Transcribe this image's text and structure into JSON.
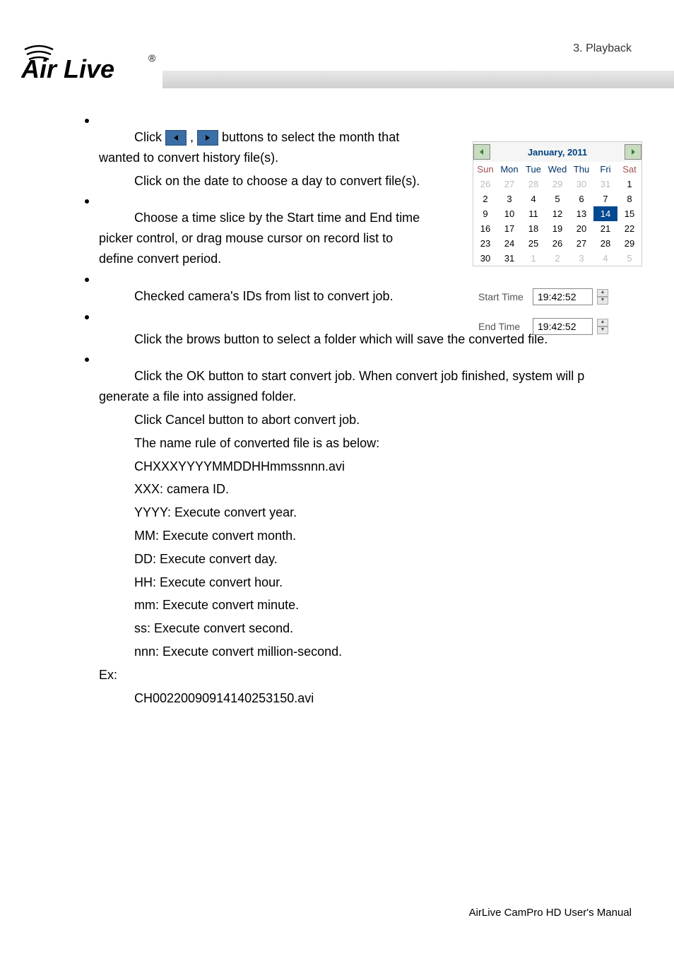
{
  "header": {
    "section_label": "3. Playback",
    "logo_alt": "Air Live"
  },
  "content": {
    "p1a": "Click ",
    "p1b": " , ",
    "p1c": " buttons to select the month that wanted to convert history file(s).",
    "p2": "Click on the date to choose a day to convert file(s).",
    "p3": " Choose a time slice by the Start time and End time picker control, or drag mouse cursor on record list to define convert period.",
    "p4": "Checked camera's IDs from list to convert job.",
    "p5": "Click the brows button to select a folder which will save the converted file.",
    "p6": "Click the OK button to start convert job. When convert job finished, system will p generate a file into assigned folder.",
    "p7": "Click Cancel button to abort convert job.",
    "p8": "The name rule of converted file is as below:",
    "p9": "CHXXXYYYYMMDDHHmmssnnn.avi",
    "p10": "XXX: camera ID.",
    "p11": "YYYY: Execute convert year.",
    "p12": "MM: Execute convert month.",
    "p13": "DD: Execute convert day.",
    "p14": "HH: Execute convert hour.",
    "p15": "mm: Execute convert minute.",
    "p16": "ss: Execute convert second.",
    "p17": "nnn: Execute convert million-second.",
    "ex_label": "Ex:",
    "ex_value": "CH00220090914140253150.avi"
  },
  "calendar": {
    "title": "January, 2011",
    "days": [
      "Sun",
      "Mon",
      "Tue",
      "Wed",
      "Thu",
      "Fri",
      "Sat"
    ],
    "weeks": [
      [
        {
          "d": "26",
          "dim": true
        },
        {
          "d": "27",
          "dim": true
        },
        {
          "d": "28",
          "dim": true
        },
        {
          "d": "29",
          "dim": true
        },
        {
          "d": "30",
          "dim": true
        },
        {
          "d": "31",
          "dim": true
        },
        {
          "d": "1"
        }
      ],
      [
        {
          "d": "2"
        },
        {
          "d": "3"
        },
        {
          "d": "4"
        },
        {
          "d": "5"
        },
        {
          "d": "6"
        },
        {
          "d": "7"
        },
        {
          "d": "8"
        }
      ],
      [
        {
          "d": "9"
        },
        {
          "d": "10"
        },
        {
          "d": "11"
        },
        {
          "d": "12"
        },
        {
          "d": "13"
        },
        {
          "d": "14",
          "sel": true
        },
        {
          "d": "15"
        }
      ],
      [
        {
          "d": "16"
        },
        {
          "d": "17"
        },
        {
          "d": "18"
        },
        {
          "d": "19"
        },
        {
          "d": "20"
        },
        {
          "d": "21"
        },
        {
          "d": "22"
        }
      ],
      [
        {
          "d": "23"
        },
        {
          "d": "24"
        },
        {
          "d": "25"
        },
        {
          "d": "26"
        },
        {
          "d": "27"
        },
        {
          "d": "28"
        },
        {
          "d": "29"
        }
      ],
      [
        {
          "d": "30"
        },
        {
          "d": "31"
        },
        {
          "d": "1",
          "dim": true
        },
        {
          "d": "2",
          "dim": true
        },
        {
          "d": "3",
          "dim": true
        },
        {
          "d": "4",
          "dim": true
        },
        {
          "d": "5",
          "dim": true
        }
      ]
    ]
  },
  "time": {
    "start_label": "Start Time",
    "start_value": "19:42:52",
    "end_label": "End Time",
    "end_value": "19:42:52"
  },
  "footer": {
    "text": "AirLive CamPro HD User's Manual"
  }
}
